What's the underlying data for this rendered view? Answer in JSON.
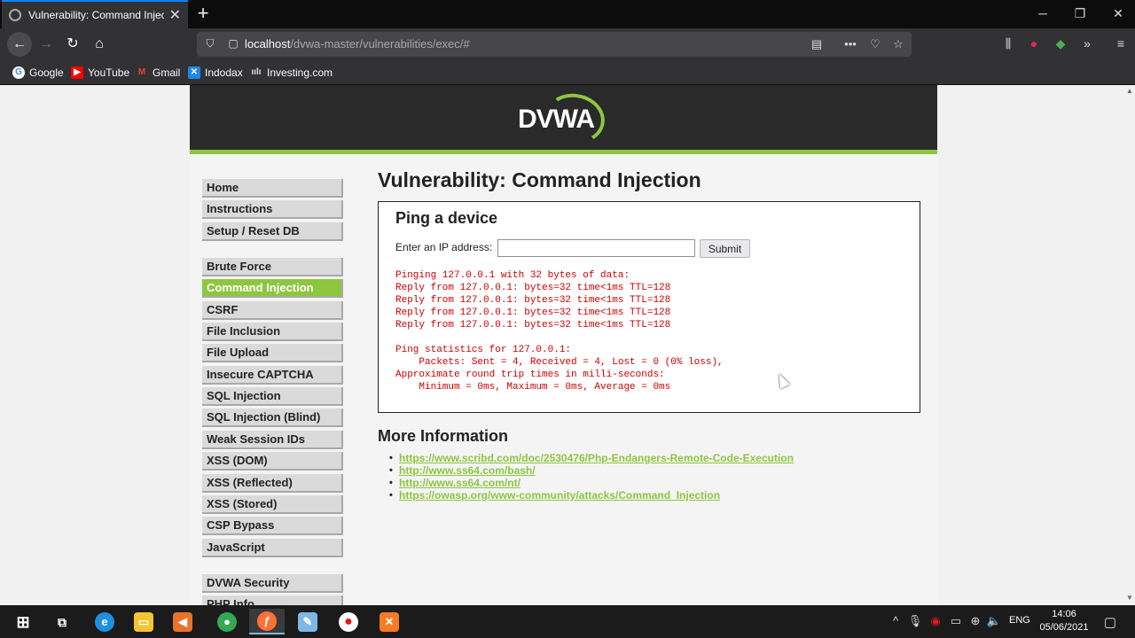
{
  "browser": {
    "tab_title": "Vulnerability: Command Injection",
    "new_tab_label": "+",
    "url_host": "localhost",
    "url_path": "/dvwa-master/vulnerabilities/exec/#",
    "bookmarks": [
      {
        "label": "Google",
        "icon": "google-icon",
        "color": "#4285f4"
      },
      {
        "label": "YouTube",
        "icon": "youtube-icon",
        "color": "#ff0000"
      },
      {
        "label": "Gmail",
        "icon": "gmail-icon",
        "color": "#ea4335"
      },
      {
        "label": "Indodax",
        "icon": "indodax-icon",
        "color": "#1e88e5"
      },
      {
        "label": "Investing.com",
        "icon": "investing-icon",
        "color": "#444444"
      }
    ]
  },
  "header": {
    "logo_text": "DVWA",
    "accent_color": "#8dc63f"
  },
  "menu": {
    "items": [
      {
        "label": "Home"
      },
      {
        "label": "Instructions"
      },
      {
        "label": "Setup / Reset DB"
      },
      {
        "label": "Brute Force"
      },
      {
        "label": "Command Injection",
        "selected": true
      },
      {
        "label": "CSRF"
      },
      {
        "label": "File Inclusion"
      },
      {
        "label": "File Upload"
      },
      {
        "label": "Insecure CAPTCHA"
      },
      {
        "label": "SQL Injection"
      },
      {
        "label": "SQL Injection (Blind)"
      },
      {
        "label": "Weak Session IDs"
      },
      {
        "label": "XSS (DOM)"
      },
      {
        "label": "XSS (Reflected)"
      },
      {
        "label": "XSS (Stored)"
      },
      {
        "label": "CSP Bypass"
      },
      {
        "label": "JavaScript"
      },
      {
        "label": "DVWA Security"
      },
      {
        "label": "PHP Info"
      }
    ]
  },
  "main": {
    "title": "Vulnerability: Command Injection",
    "ping": {
      "heading": "Ping a device",
      "ip_label": "Enter an IP address:",
      "ip_value": "",
      "submit_label": "Submit",
      "output": "Pinging 127.0.0.1 with 32 bytes of data:\nReply from 127.0.0.1: bytes=32 time<1ms TTL=128\nReply from 127.0.0.1: bytes=32 time<1ms TTL=128\nReply from 127.0.0.1: bytes=32 time<1ms TTL=128\nReply from 127.0.0.1: bytes=32 time<1ms TTL=128\n\nPing statistics for 127.0.0.1:\n    Packets: Sent = 4, Received = 4, Lost = 0 (0% loss),\nApproximate round trip times in milli-seconds:\n    Minimum = 0ms, Maximum = 0ms, Average = 0ms"
    },
    "more_info": {
      "heading": "More Information",
      "links": [
        "https://www.scribd.com/doc/2530476/Php-Endangers-Remote-Code-Execution",
        "http://www.ss64.com/bash/",
        "http://www.ss64.com/nt/",
        "https://owasp.org/www-community/attacks/Command_Injection"
      ]
    }
  },
  "taskbar": {
    "apps": [
      {
        "icon": "edge-icon",
        "color": "#1f8fe0"
      },
      {
        "icon": "file-explorer-icon",
        "color": "#f4c431"
      },
      {
        "icon": "media-player-icon",
        "color": "#e8742c"
      },
      {
        "icon": "chrome-icon",
        "color": "#34a853"
      },
      {
        "icon": "firefox-icon",
        "color": "#ff7139",
        "active": true
      },
      {
        "icon": "notepad-icon",
        "color": "#7fb8e6"
      },
      {
        "icon": "recorder-icon",
        "color": "#e81123"
      },
      {
        "icon": "xampp-icon",
        "color": "#fb7a24"
      }
    ],
    "language": "ENG",
    "time": "14:06",
    "date": "05/06/2021"
  }
}
